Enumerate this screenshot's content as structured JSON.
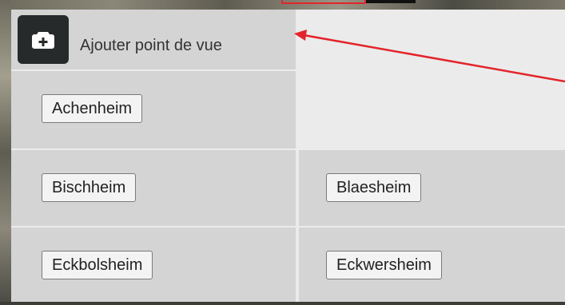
{
  "add_viewpoint": {
    "label": "Ajouter point de vue",
    "icon": "camera-plus-icon"
  },
  "communes": [
    {
      "row": 1,
      "col": 1,
      "label": "Achenheim"
    },
    {
      "row": 2,
      "col": 1,
      "label": "Bischheim"
    },
    {
      "row": 2,
      "col": 2,
      "label": "Blaesheim"
    },
    {
      "row": 3,
      "col": 1,
      "label": "Eckbolsheim"
    },
    {
      "row": 3,
      "col": 2,
      "label": "Eckwersheim"
    }
  ],
  "colors": {
    "panel_bg": "#ebebeb",
    "cell_bg": "#d4d4d4",
    "add_button_bg": "#262a2b",
    "annotation": "#e3242b"
  }
}
